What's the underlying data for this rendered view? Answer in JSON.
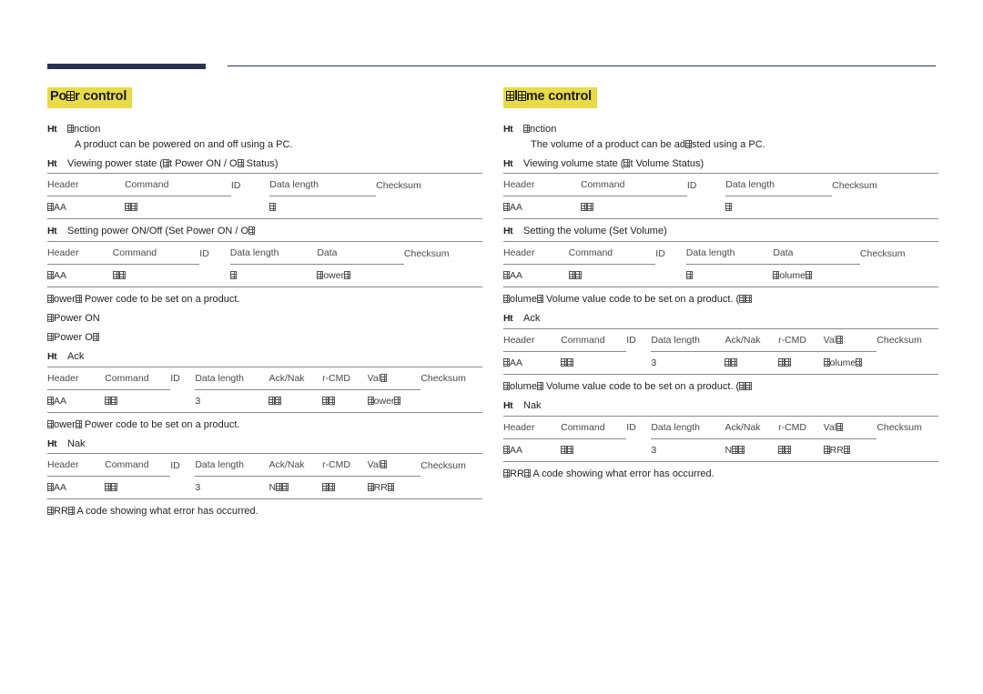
{
  "document": {
    "header_rule": {
      "thick_color": "#2e3252",
      "thin_color": "#2e3252"
    },
    "highlight_color": "#e7db47",
    "bullet_marker": "Ht"
  },
  "columns": [
    {
      "id": "power-control",
      "heading": "Po▯r control",
      "blocks": [
        {
          "kind": "bullet",
          "label": "Ht",
          "text": "▯nction"
        },
        {
          "kind": "sub",
          "text": "A product can be powered on and off using a PC."
        },
        {
          "kind": "bullet",
          "label": "Ht",
          "text": "Viewing power state (▯t Power ON / O▯ Status)"
        },
        {
          "kind": "table",
          "id": "get-power-status",
          "headers": [
            "Header",
            "Command",
            "ID",
            "Data length",
            "Checksum"
          ],
          "values": [
            "▯AA",
            "▯▯",
            "",
            "▯",
            ""
          ],
          "underline": [
            true,
            true,
            false,
            true,
            false
          ],
          "closed": true
        },
        {
          "kind": "bullet",
          "label": "Ht",
          "text": "Setting power ON/Off (Set Power ON / O▯"
        },
        {
          "kind": "table",
          "id": "set-power",
          "headers": [
            "Header",
            "Command",
            "ID",
            "Data length",
            "Data",
            "Checksum"
          ],
          "values": [
            "▯AA",
            "▯▯",
            "",
            "▯",
            "▯ower▯",
            ""
          ],
          "underline": [
            true,
            true,
            false,
            true,
            true,
            false
          ],
          "closed": true
        },
        {
          "kind": "note",
          "text": "▯ower▯ Power code to be set on a product."
        },
        {
          "kind": "note",
          "text": "▯Power ON"
        },
        {
          "kind": "note",
          "text": "▯Power O▯"
        },
        {
          "kind": "bullet",
          "label": "Ht",
          "text": "Ack"
        },
        {
          "kind": "table",
          "id": "power-ack",
          "headers": [
            "Header",
            "Command",
            "ID",
            "Data length",
            "Ack/Nak",
            "r-CMD",
            "Val▯",
            "Checksum"
          ],
          "values": [
            "▯AA",
            "▯▯",
            "",
            "3",
            "▯▯",
            "▯▯",
            "▯ower▯",
            ""
          ],
          "underline": [
            true,
            true,
            false,
            true,
            true,
            true,
            true,
            false
          ],
          "closed": true
        },
        {
          "kind": "note",
          "text": "▯ower▯ Power code to be set on a product."
        },
        {
          "kind": "bullet",
          "label": "Ht",
          "text": "Nak"
        },
        {
          "kind": "table",
          "id": "power-nak",
          "headers": [
            "Header",
            "Command",
            "ID",
            "Data length",
            "Ack/Nak",
            "r-CMD",
            "Val▯",
            "Checksum"
          ],
          "values": [
            "▯AA",
            "▯▯",
            "",
            "3",
            "N▯▯",
            "▯▯",
            "▯RR▯",
            ""
          ],
          "underline": [
            true,
            true,
            false,
            true,
            true,
            true,
            true,
            false
          ],
          "closed": true
        },
        {
          "kind": "note",
          "text": "▯RR▯ A code showing what error has occurred."
        }
      ]
    },
    {
      "id": "volume-control",
      "heading": "▯l▯me control",
      "blocks": [
        {
          "kind": "bullet",
          "label": "Ht",
          "text": "▯nction"
        },
        {
          "kind": "sub",
          "text": "The volume of a product can be ad▯sted using a PC."
        },
        {
          "kind": "bullet",
          "label": "Ht",
          "text": "Viewing volume state (▯t Volume Status)"
        },
        {
          "kind": "table",
          "id": "get-volume-status",
          "headers": [
            "Header",
            "Command",
            "ID",
            "Data length",
            "Checksum"
          ],
          "values": [
            "▯AA",
            "▯▯",
            "",
            "▯",
            ""
          ],
          "underline": [
            true,
            true,
            false,
            true,
            false
          ],
          "closed": true
        },
        {
          "kind": "bullet",
          "label": "Ht",
          "text": "Setting the volume (Set Volume)"
        },
        {
          "kind": "table",
          "id": "set-volume",
          "headers": [
            "Header",
            "Command",
            "ID",
            "Data length",
            "Data",
            "Checksum"
          ],
          "values": [
            "▯AA",
            "▯▯",
            "",
            "▯",
            "▯olume▯",
            ""
          ],
          "underline": [
            true,
            true,
            false,
            true,
            true,
            false
          ],
          "closed": true
        },
        {
          "kind": "note",
          "text": "▯olume▯ Volume value code to be set on a product. (▯▯"
        },
        {
          "kind": "bullet",
          "label": "Ht",
          "text": "Ack"
        },
        {
          "kind": "table",
          "id": "volume-ack",
          "headers": [
            "Header",
            "Command",
            "ID",
            "Data length",
            "Ack/Nak",
            "r-CMD",
            "Val▯",
            "Checksum"
          ],
          "values": [
            "▯AA",
            "▯▯",
            "",
            "3",
            "▯▯",
            "▯▯",
            "▯olume▯",
            ""
          ],
          "underline": [
            true,
            true,
            false,
            true,
            true,
            true,
            true,
            false
          ],
          "closed": true
        },
        {
          "kind": "note",
          "text": "▯olume▯ Volume value code to be set on a product. (▯▯"
        },
        {
          "kind": "bullet",
          "label": "Ht",
          "text": "Nak"
        },
        {
          "kind": "table",
          "id": "volume-nak",
          "headers": [
            "Header",
            "Command",
            "ID",
            "Data length",
            "Ack/Nak",
            "r-CMD",
            "Val▯",
            "Checksum"
          ],
          "values": [
            "▯AA",
            "▯▯",
            "",
            "3",
            "N▯▯",
            "▯▯",
            "▯RR▯",
            ""
          ],
          "underline": [
            true,
            true,
            false,
            true,
            true,
            true,
            true,
            false
          ],
          "closed": true
        },
        {
          "kind": "note",
          "text": "▯RR▯ A code showing what error has occurred."
        }
      ]
    }
  ]
}
